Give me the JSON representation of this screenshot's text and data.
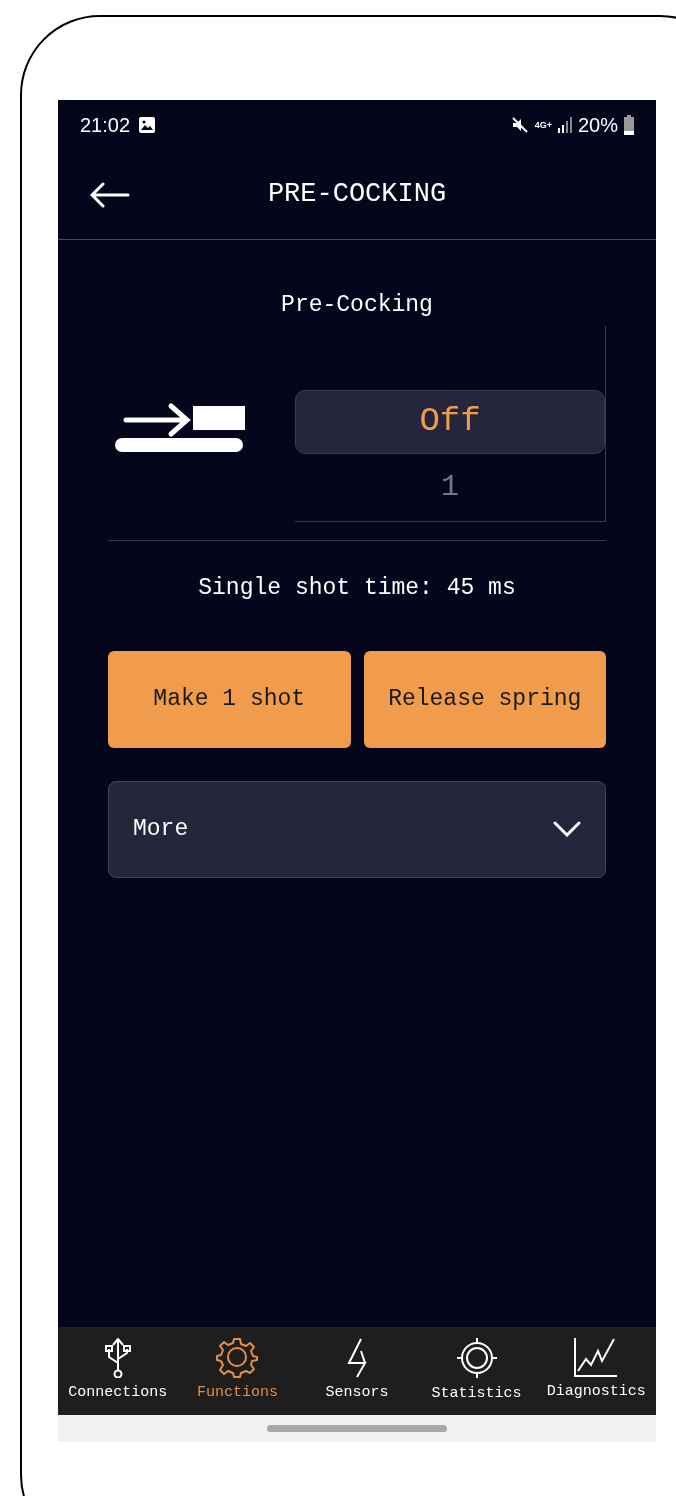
{
  "status_bar": {
    "time": "21:02",
    "network": "4G+",
    "battery": "20%"
  },
  "header": {
    "title": "PRE-COCKING"
  },
  "picker": {
    "label": "Pre-Cocking",
    "options": [
      {
        "label": "Off",
        "selected": true
      },
      {
        "label": "1",
        "selected": false
      }
    ]
  },
  "info": "Single shot time: 45 ms",
  "buttons": [
    "Make 1 shot",
    "Release spring"
  ],
  "dropdown": {
    "label": "More",
    "expanded": false
  },
  "nav": [
    {
      "label": "Connections",
      "selected": false
    },
    {
      "label": "Functions",
      "selected": true
    },
    {
      "label": "Sensors",
      "selected": false
    },
    {
      "label": "Statistics",
      "selected": false
    },
    {
      "label": "Diagnostics",
      "selected": false
    }
  ]
}
